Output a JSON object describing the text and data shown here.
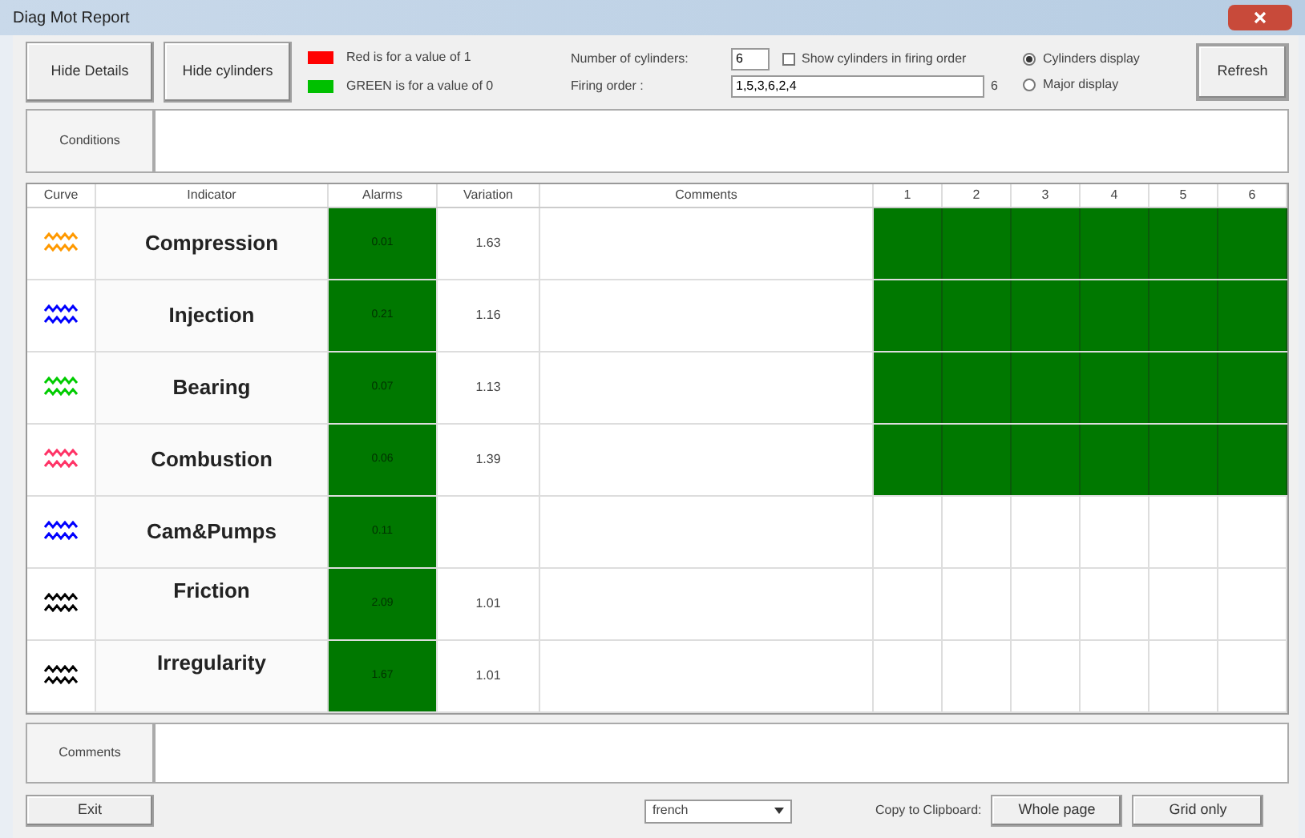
{
  "window": {
    "title": "Diag Mot Report"
  },
  "toolbar": {
    "buttons": [
      "Hide Details",
      "Hide cylinders"
    ],
    "legend": [
      {
        "color": "#ff0000",
        "label": "Red is for a value of 1"
      },
      {
        "color": "#00c000",
        "label": "GREEN is for a value of 0"
      }
    ],
    "cylinders_label": "Number of cylinders:",
    "cylinders_value": "6",
    "show_firing_order": {
      "label": "Show cylinders in firing order",
      "checked": false
    },
    "firing_label": "Firing order :",
    "firing_value": "1,5,3,6,2,4",
    "firing_suffix": "6",
    "display_options": [
      {
        "label": "Cylinders display",
        "selected": true
      },
      {
        "label": "Major display",
        "selected": false
      }
    ],
    "refresh": "Refresh"
  },
  "conditions": {
    "label": "Conditions"
  },
  "table": {
    "columns": [
      "Curve",
      "Indicator",
      "Alarms",
      "Variation",
      "Comments",
      "1",
      "2",
      "3",
      "4",
      "5",
      "6"
    ],
    "rows": [
      {
        "color": "#ff9900",
        "indicator": "Compression",
        "alarm": "0.01",
        "variation": "1.63",
        "cylinders": [
          {
            "color": "#007800"
          },
          {
            "color": "#007800"
          },
          {
            "color": "#007800"
          },
          {
            "color": "#007800"
          },
          {
            "color": "#007800"
          },
          {
            "color": "#007800"
          }
        ]
      },
      {
        "color": "#0000ff",
        "indicator": "Injection",
        "alarm": "0.21",
        "variation": "1.16",
        "cylinders": [
          {
            "color": "#007800"
          },
          {
            "color": "#007800"
          },
          {
            "color": "#007800"
          },
          {
            "color": "#007800"
          },
          {
            "color": "#007800"
          },
          {
            "color": "#007800"
          }
        ]
      },
      {
        "color": "#00cc00",
        "indicator": "Bearing",
        "alarm": "0.07",
        "variation": "1.13",
        "cylinders": [
          {
            "color": "#007800"
          },
          {
            "color": "#007800"
          },
          {
            "color": "#007800"
          },
          {
            "color": "#007800"
          },
          {
            "color": "#007800"
          },
          {
            "color": "#007800"
          }
        ]
      },
      {
        "color": "#ff3366",
        "indicator": "Combustion",
        "alarm": "0.06",
        "variation": "1.39",
        "cylinders": [
          {
            "color": "#007800"
          },
          {
            "color": "#007800"
          },
          {
            "color": "#007800"
          },
          {
            "color": "#007800"
          },
          {
            "color": "#007800"
          },
          {
            "color": "#007800"
          }
        ]
      },
      {
        "color": "#0000ff",
        "indicator": "Cam&Pumps",
        "alarm": "0.11"
      },
      {
        "color": "#000000",
        "indicator": "Friction",
        "alarm": "2.09",
        "variation": "1.01"
      },
      {
        "color": "#000000",
        "indicator": "Irregularity",
        "alarm": "1.67",
        "variation": "1.01"
      }
    ]
  },
  "comments": {
    "label": "Comments"
  },
  "footer": {
    "exit": "Exit",
    "language": "french",
    "copy_label": "Copy to Clipboard:",
    "buttons": [
      "Whole page",
      "Grid only"
    ]
  }
}
